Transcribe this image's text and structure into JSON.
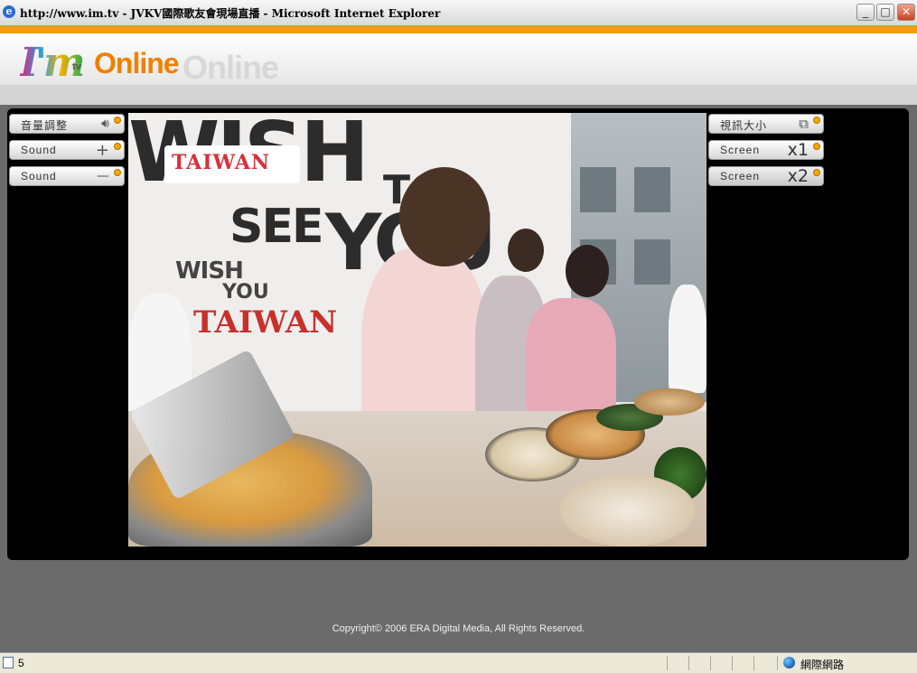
{
  "window": {
    "title": "http://www.im.tv - JVKV國際歌友會現場直播 - Microsoft Internet Explorer",
    "buttons": {
      "minimize": "_",
      "maximize": "□",
      "close": "✕"
    }
  },
  "header": {
    "logo_im": "I'm",
    "logo_tv": "tv",
    "logo_online": "Online",
    "logo_online_ghost": "Online"
  },
  "controls": {
    "left": [
      {
        "label": "音量調整",
        "symbol": "🔊︎",
        "icon": "speaker-icon"
      },
      {
        "label": "Sound",
        "symbol": "+",
        "icon": "plus-icon"
      },
      {
        "label": "Sound",
        "symbol": "—",
        "icon": "minus-icon"
      }
    ],
    "right": [
      {
        "label": "視訊大小",
        "symbol": "⧉",
        "icon": "resize-icon"
      },
      {
        "label": "Screen",
        "symbol": "x1",
        "icon": ""
      },
      {
        "label": "Screen",
        "symbol": "x2",
        "icon": ""
      }
    ]
  },
  "video": {
    "wall_text_1": "WISH",
    "wall_text_2": "TO",
    "wall_text_3": "SEE",
    "wall_text_4": "YOU",
    "logo_text": "TAIWAN",
    "poster_text_1": "WISH",
    "poster_text_2": "YOU",
    "poster_text_3": "TAIWAN"
  },
  "footer": {
    "copyright": "Copyright© 2006 ERA Digital Media, All Rights Reserved."
  },
  "statusbar": {
    "status_text": "5",
    "zone": "網際網路"
  },
  "colors": {
    "accent_orange": "#f59a00",
    "panel_black": "#000000",
    "page_gray": "#6b6b6b",
    "indicator_dot": "#f4a800"
  }
}
